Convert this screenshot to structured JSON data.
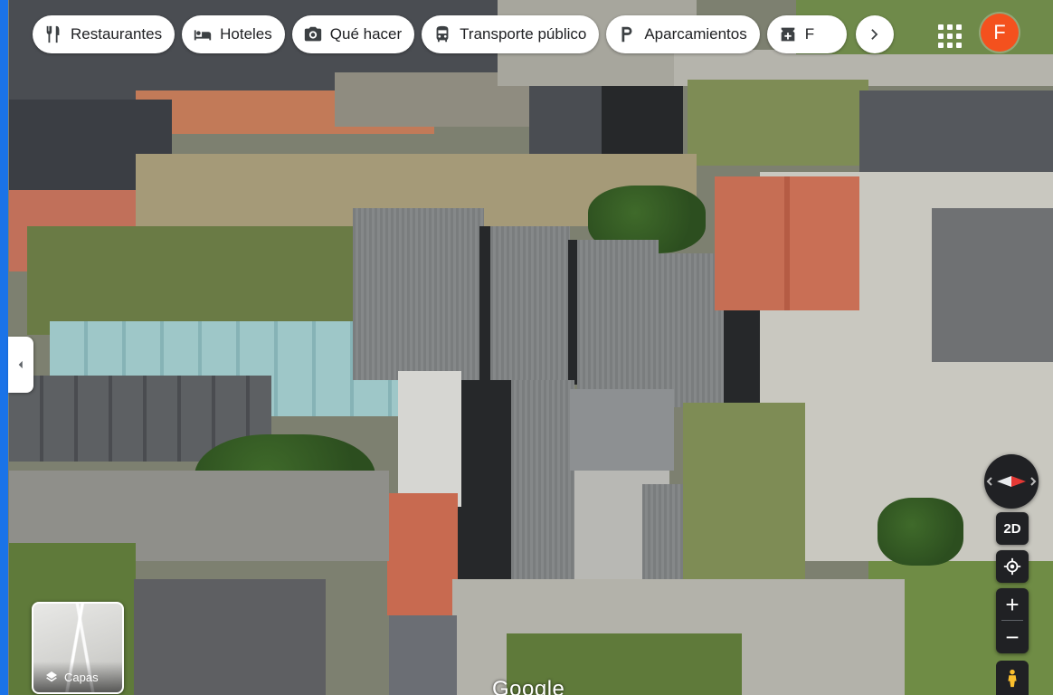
{
  "chips": [
    {
      "label": "Restaurantes",
      "icon": "restaurant-icon"
    },
    {
      "label": "Hoteles",
      "icon": "hotel-icon"
    },
    {
      "label": "Qué hacer",
      "icon": "camera-icon"
    },
    {
      "label": "Transporte público",
      "icon": "transit-icon"
    },
    {
      "label": "Aparcamientos",
      "icon": "parking-icon"
    },
    {
      "label": "F",
      "icon": "pharmacy-icon"
    }
  ],
  "account": {
    "initial": "F",
    "color": "#f4511e"
  },
  "layers": {
    "label": "Capas"
  },
  "controls": {
    "view_mode": "2D",
    "zoom_in": "+",
    "zoom_out": "−"
  },
  "attribution": "Google",
  "colors": {
    "accent_strip": "#1a73e8",
    "control_bg": "#202124"
  }
}
